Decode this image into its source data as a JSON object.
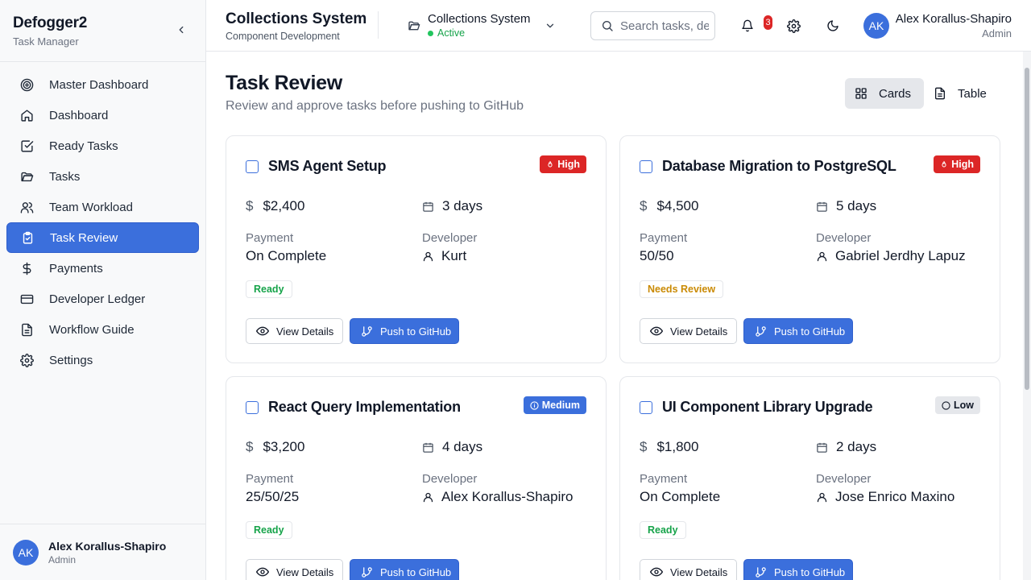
{
  "app": {
    "name": "Defogger2",
    "subtitle": "Task Manager",
    "collapse_icon": "chevron-left-icon"
  },
  "sidebar": {
    "items": [
      {
        "label": "Master Dashboard",
        "icon": "target-icon"
      },
      {
        "label": "Dashboard",
        "icon": "home-icon"
      },
      {
        "label": "Ready Tasks",
        "icon": "check-square-icon"
      },
      {
        "label": "Tasks",
        "icon": "folder-open-icon"
      },
      {
        "label": "Team Workload",
        "icon": "users-icon"
      },
      {
        "label": "Task Review",
        "icon": "clipboard-check-icon",
        "active": true
      },
      {
        "label": "Payments",
        "icon": "dollar-icon"
      },
      {
        "label": "Developer Ledger",
        "icon": "credit-card-icon"
      },
      {
        "label": "Workflow Guide",
        "icon": "file-text-icon"
      },
      {
        "label": "Settings",
        "icon": "gear-icon"
      }
    ],
    "user": {
      "initials": "AK",
      "name": "Alex Korallus-Shapiro",
      "role": "Admin"
    }
  },
  "header": {
    "project_title": "Collections System",
    "project_subtitle": "Component Development",
    "switcher": {
      "name": "Collections System",
      "status": "Active"
    },
    "search_placeholder": "Search tasks, developers...",
    "notification_count": "3",
    "user": {
      "initials": "AK",
      "name": "Alex Korallus-Shapiro",
      "role": "Admin"
    }
  },
  "page": {
    "title": "Task Review",
    "subtitle": "Review and approve tasks before pushing to GitHub",
    "view_toggle": {
      "cards": "Cards",
      "table": "Table",
      "active": "cards"
    }
  },
  "labels": {
    "payment": "Payment",
    "developer": "Developer",
    "view_details": "View Details",
    "push": "Push to GitHub"
  },
  "colors": {
    "accent": "#3b6fdc",
    "high": "#dc2626",
    "ready": "#16a34a",
    "needs_review": "#ca8a04"
  },
  "tasks": [
    {
      "title": "SMS Agent Setup",
      "priority": "High",
      "amount": "$2,400",
      "duration": "3 days",
      "payment": "On Complete",
      "developer": "Kurt",
      "status": "Ready"
    },
    {
      "title": "Database Migration to PostgreSQL",
      "priority": "High",
      "amount": "$4,500",
      "duration": "5 days",
      "payment": "50/50",
      "developer": "Gabriel Jerdhy Lapuz",
      "status": "Needs Review"
    },
    {
      "title": "React Query Implementation",
      "priority": "Medium",
      "amount": "$3,200",
      "duration": "4 days",
      "payment": "25/50/25",
      "developer": "Alex Korallus-Shapiro",
      "status": "Ready"
    },
    {
      "title": "UI Component Library Upgrade",
      "priority": "Low",
      "amount": "$1,800",
      "duration": "2 days",
      "payment": "On Complete",
      "developer": "Jose Enrico Maxino",
      "status": "Ready"
    }
  ]
}
